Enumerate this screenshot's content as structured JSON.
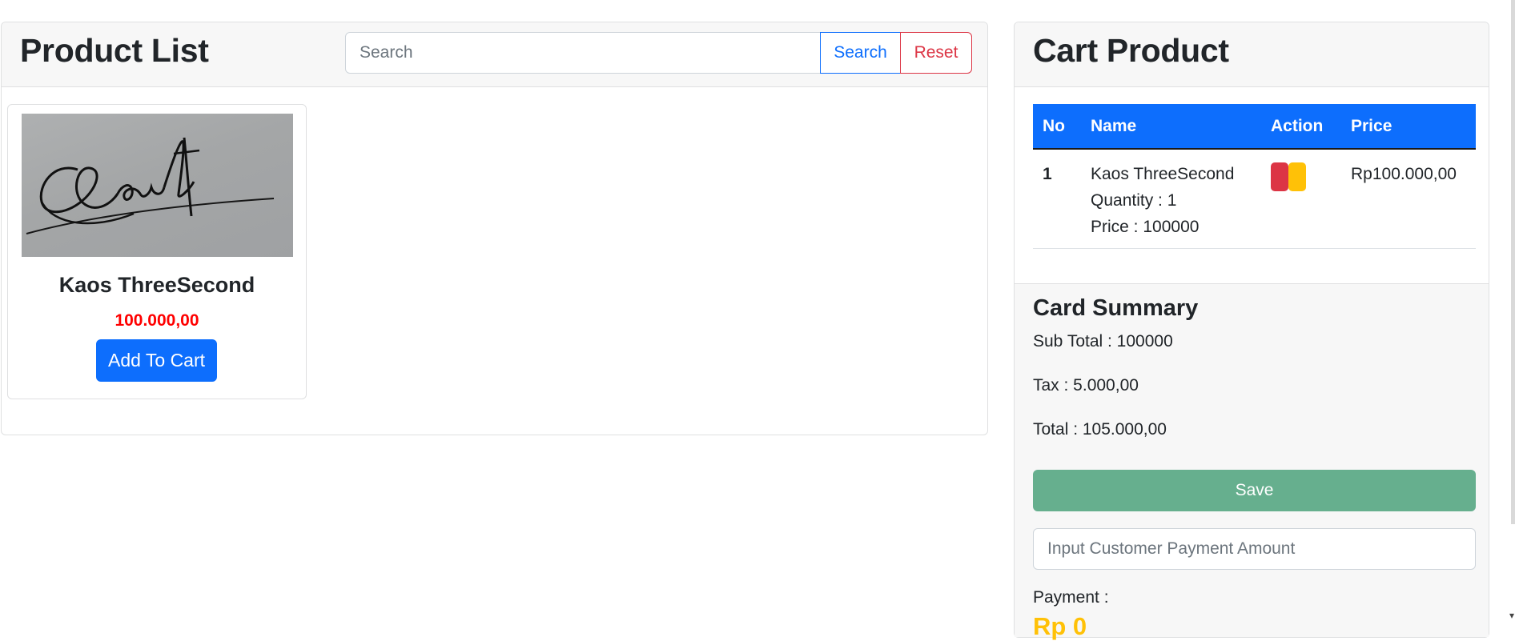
{
  "product_list": {
    "title": "Product List",
    "search_placeholder": "Search",
    "search_button": "Search",
    "reset_button": "Reset",
    "products": [
      {
        "name": "Kaos ThreeSecond",
        "price": "100.000,00",
        "add_button": "Add To Cart",
        "image": "signature-image"
      }
    ]
  },
  "cart": {
    "title": "Cart Product",
    "columns": [
      "No",
      "Name",
      "Action",
      "Price"
    ],
    "rows": [
      {
        "no": "1",
        "name": "Kaos ThreeSecond",
        "quantity": "Quantity : 1",
        "unit_price": "Price : 100000",
        "price": "Rp100.000,00"
      }
    ],
    "summary": {
      "title": "Card Summary",
      "sub_total": "Sub Total : 100000",
      "tax": "Tax : 5.000,00",
      "total": "Total : 105.000,00",
      "save_button": "Save",
      "payment_placeholder": "Input Customer Payment Amount",
      "payment_label": "Payment :",
      "payment_value": "Rp 0"
    }
  },
  "colors": {
    "primary": "#0d6efd",
    "danger": "#dc3545",
    "warning": "#ffc107",
    "success": "#66af8e",
    "price_red": "#ff0000"
  }
}
